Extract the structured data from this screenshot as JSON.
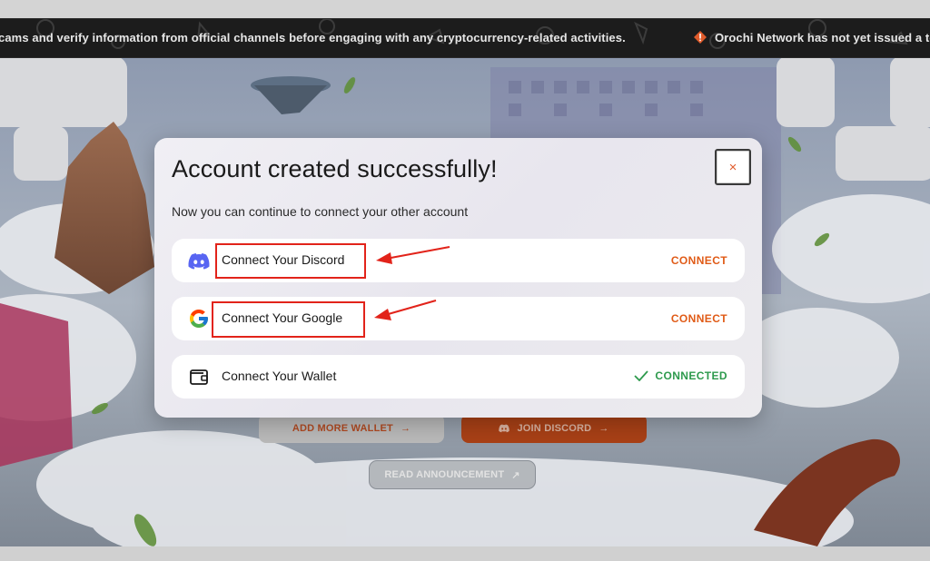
{
  "ticker": {
    "text_a": "cams and verify information from official channels before engaging with any cryptocurrency-related activities.",
    "text_b": "Orochi Network has not yet issued a toke"
  },
  "page_buttons": {
    "add_more_wallet": "ADD MORE WALLET",
    "join_discord": "JOIN DISCORD",
    "read_announcement": "READ ANNOUNCEMENT"
  },
  "modal": {
    "title": "Account created successfully!",
    "subtitle": "Now you can continue to connect your other account",
    "close_symbol": "×",
    "rows": [
      {
        "label": "Connect Your Discord",
        "action": "CONNECT",
        "icon": "discord-icon",
        "status": "not-connected"
      },
      {
        "label": "Connect Your Google",
        "action": "CONNECT",
        "icon": "google-icon",
        "status": "not-connected"
      },
      {
        "label": "Connect Your Wallet",
        "action": "CONNECTED",
        "icon": "wallet-icon",
        "status": "connected"
      }
    ]
  },
  "colors": {
    "accent": "#e05b17",
    "connected": "#2e9a4d",
    "highlight": "#e2231a",
    "discord": "#5865f2"
  }
}
